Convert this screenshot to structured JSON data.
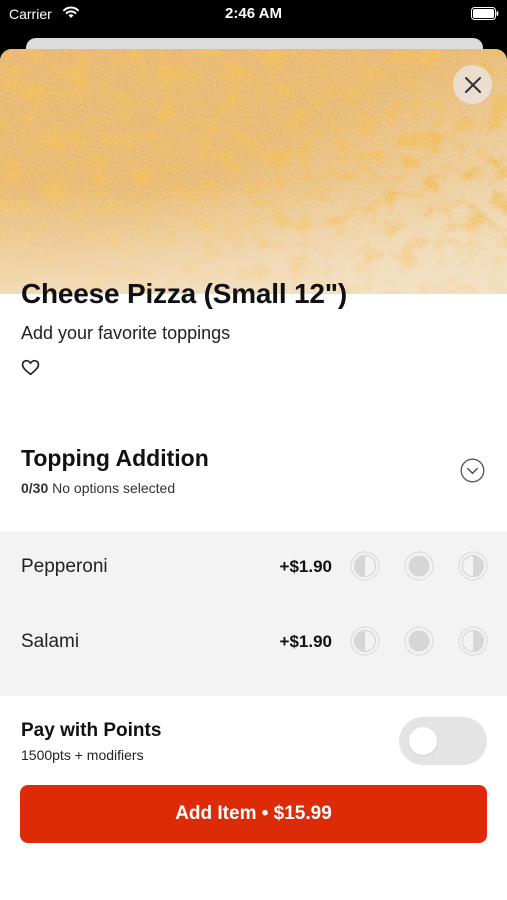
{
  "status_bar": {
    "carrier": "Carrier",
    "time": "2:46 AM",
    "icons": [
      "wifi-icon",
      "battery-icon"
    ]
  },
  "item": {
    "title": "Cheese Pizza (Small 12\")",
    "description": "Add your favorite toppings",
    "image": "cheese-pizza-photo",
    "favorited": false
  },
  "topping_section": {
    "title": "Topping Addition",
    "count": "0/30",
    "status": "No options selected",
    "expanded_icon": "chevron-down-icon"
  },
  "options": [
    {
      "name": "Pepperoni",
      "price": "+$1.90",
      "portions": [
        "left-half-icon",
        "whole-icon",
        "right-half-icon"
      ]
    },
    {
      "name": "Salami",
      "price": "+$1.90",
      "portions": [
        "left-half-icon",
        "whole-icon",
        "right-half-icon"
      ]
    }
  ],
  "points": {
    "title": "Pay with Points",
    "subtitle": "1500pts + modifiers",
    "enabled": false
  },
  "add_button": {
    "label": "Add Item • $15.99"
  },
  "colors": {
    "accent": "#dd2b08",
    "options_bg": "#f3f3f3",
    "toggle_off": "#e4e4e4"
  }
}
